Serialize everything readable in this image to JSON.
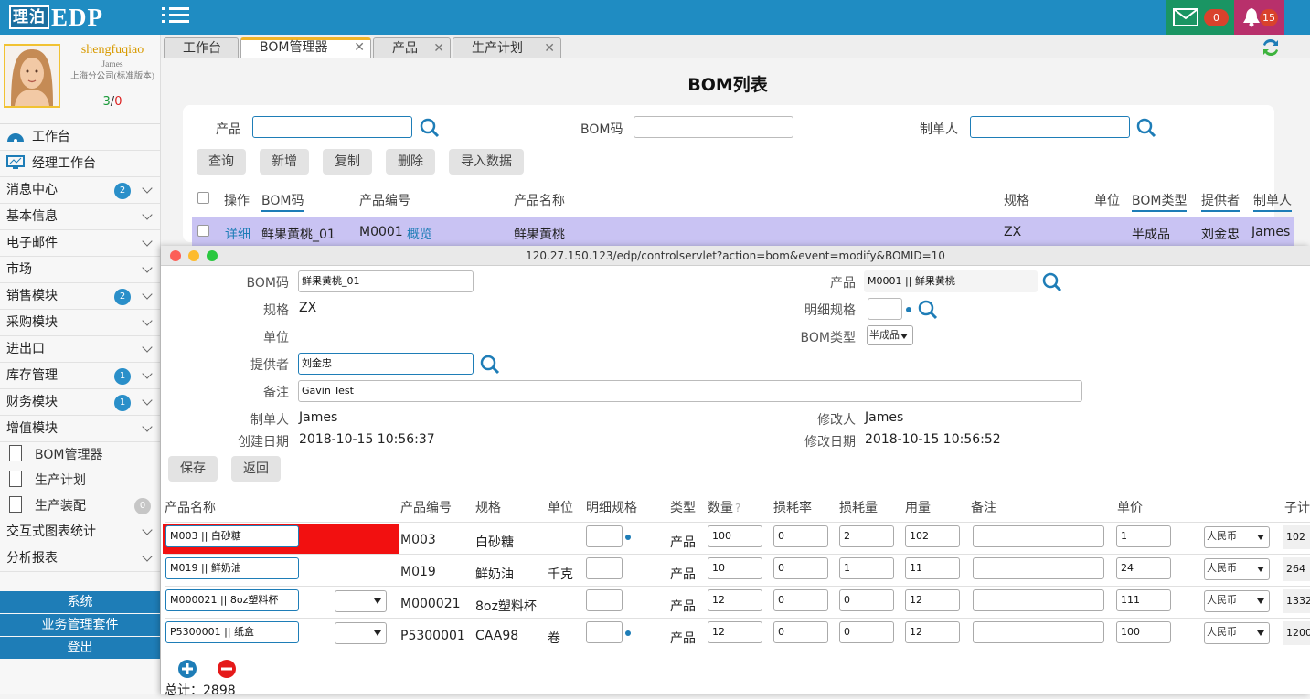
{
  "topbar": {
    "logo_box": "理泊",
    "logo_text": "EDP",
    "mail_count": "0",
    "bell_count": "15",
    "colors": {
      "bar": "#1f8cc2",
      "mail": "#1a9563",
      "bell": "#b8306b"
    }
  },
  "user": {
    "name": "shengfuqiao",
    "sub1": "James",
    "sub2": "上海分公司(标准版本)",
    "count_a": "3",
    "count_sep": "/",
    "count_b": "0"
  },
  "nav": [
    {
      "label": "工作台",
      "icon": "dashboard-icon"
    },
    {
      "label": "经理工作台",
      "icon": "monitor-icon"
    },
    {
      "label": "消息中心",
      "badge": "2"
    },
    {
      "label": "基本信息"
    },
    {
      "label": "电子邮件"
    },
    {
      "label": "市场"
    },
    {
      "label": "销售模块",
      "badge": "2"
    },
    {
      "label": "采购模块"
    },
    {
      "label": "进出口"
    },
    {
      "label": "库存管理",
      "badge": "1"
    },
    {
      "label": "财务模块",
      "badge": "1"
    },
    {
      "label": "增值模块"
    }
  ],
  "subnav": [
    {
      "label": "BOM管理器"
    },
    {
      "label": "生产计划"
    },
    {
      "label": "生产装配",
      "badge": "0"
    }
  ],
  "nav2": [
    {
      "label": "交互式图表统计"
    },
    {
      "label": "分析报表"
    }
  ],
  "side_buttons": [
    "系统",
    "业务管理套件",
    "登出"
  ],
  "tabs": [
    {
      "label": "工作台"
    },
    {
      "label": "BOM管理器"
    },
    {
      "label": "产品"
    },
    {
      "label": "生产计划"
    }
  ],
  "list": {
    "title": "BOM列表",
    "search": {
      "product_label": "产品",
      "bomcode_label": "BOM码",
      "creator_label": "制单人"
    },
    "buttons": [
      "查询",
      "新增",
      "复制",
      "删除",
      "导入数据"
    ],
    "headers": [
      "操作",
      "BOM码",
      "产品编号",
      "产品名称",
      "规格",
      "单位",
      "BOM类型",
      "提供者",
      "制单人"
    ],
    "row": {
      "action": "详细",
      "bom_code": "鲜果黄桃_01",
      "product_no": "M0001",
      "overview": "概览",
      "product_name": "鲜果黄桃",
      "spec": "ZX",
      "unit": "",
      "bom_type": "半成品",
      "provider": "刘金忠",
      "creator": "James"
    }
  },
  "modal": {
    "url": "120.27.150.123/edp/controlservlet?action=bom&event=modify&BOMID=10",
    "labels": {
      "bom_code": "BOM码",
      "spec": "规格",
      "unit": "单位",
      "provider": "提供者",
      "remark": "备注",
      "creator": "制单人",
      "created": "创建日期",
      "product": "产品",
      "detail_spec": "明细规格",
      "bom_type": "BOM类型",
      "modifier": "修改人",
      "modified": "修改日期"
    },
    "values": {
      "bom_code": "鲜果黄桃_01",
      "spec": "ZX",
      "unit": "",
      "provider": "刘金忠",
      "remark": "Gavin Test",
      "creator": "James",
      "created": "2018-10-15 10:56:37",
      "product": "M0001 || 鲜果黄桃",
      "detail_spec": "",
      "bom_type": "半成品",
      "modifier": "James",
      "modified": "2018-10-15 10:56:52"
    },
    "buttons": {
      "save": "保存",
      "back": "返回"
    },
    "table_headers": [
      "产品名称",
      "产品编号",
      "规格",
      "单位",
      "明细规格",
      "类型",
      "数量",
      "损耗率",
      "损耗量",
      "用量",
      "备注",
      "单价",
      "子计"
    ],
    "rows": [
      {
        "name": "M003 || 白砂糖",
        "code": "M003",
        "spec": "白砂糖",
        "unit": "",
        "type": "产品",
        "qty": "100",
        "loss_rate": "0",
        "loss_qty": "2",
        "usage": "102",
        "remark": "",
        "price": "1",
        "currency": "人民币",
        "subtotal": "102"
      },
      {
        "name": "M019 || 鲜奶油",
        "code": "M019",
        "spec": "鲜奶油",
        "unit": "千克",
        "type": "产品",
        "qty": "10",
        "loss_rate": "0",
        "loss_qty": "1",
        "usage": "11",
        "remark": "",
        "price": "24",
        "currency": "人民币",
        "subtotal": "264"
      },
      {
        "name": "M000021 || 8oz塑料杯",
        "code": "M000021",
        "spec": "8oz塑料杯",
        "unit": "",
        "type": "产品",
        "qty": "12",
        "loss_rate": "0",
        "loss_qty": "0",
        "usage": "12",
        "remark": "",
        "price": "111",
        "currency": "人民币",
        "subtotal": "1332"
      },
      {
        "name": "P5300001 || 纸盒",
        "code": "P5300001",
        "spec": "CAA98",
        "unit": "卷",
        "type": "产品",
        "qty": "12",
        "loss_rate": "0",
        "loss_qty": "0",
        "usage": "12",
        "remark": "",
        "price": "100",
        "currency": "人民币",
        "subtotal": "1200"
      }
    ],
    "total": "总计：2898"
  }
}
